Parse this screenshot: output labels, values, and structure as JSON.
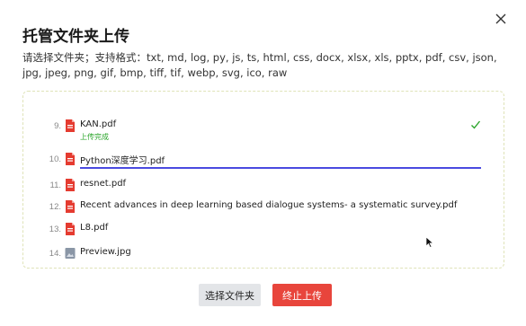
{
  "dialog": {
    "title": "托管文件夹上传",
    "description": "请选择文件夹；支持格式：txt, md, log, py, js, ts, html, css, docx, xlsx, xls, pptx, pdf, csv, json, jpg, jpeg, png, gif, bmp, tiff, tif, webp, svg, ico, raw",
    "close_icon": "close-icon"
  },
  "files": [
    {
      "index": "9.",
      "name": "KAN.pdf",
      "status": "上传完成",
      "icon": "pdf-icon",
      "done": true
    },
    {
      "index": "10.",
      "name": "Python深度学习.pdf",
      "progress": 1.0,
      "icon": "pdf-icon"
    },
    {
      "index": "11.",
      "name": "resnet.pdf",
      "icon": "pdf-icon"
    },
    {
      "index": "12.",
      "name": "Recent advances in deep learning based dialogue systems- a systematic survey.pdf",
      "icon": "pdf-icon"
    },
    {
      "index": "13.",
      "name": "L8.pdf",
      "icon": "pdf-icon"
    },
    {
      "index": "14.",
      "name": "Preview.jpg",
      "icon": "image-icon"
    }
  ],
  "buttons": {
    "select_label": "选择文件夹",
    "stop_label": "终止上传"
  },
  "colors": {
    "success": "#2aa52a",
    "progress": "#4a4ae0",
    "danger": "#e8453c",
    "pdf": "#e53b30"
  }
}
